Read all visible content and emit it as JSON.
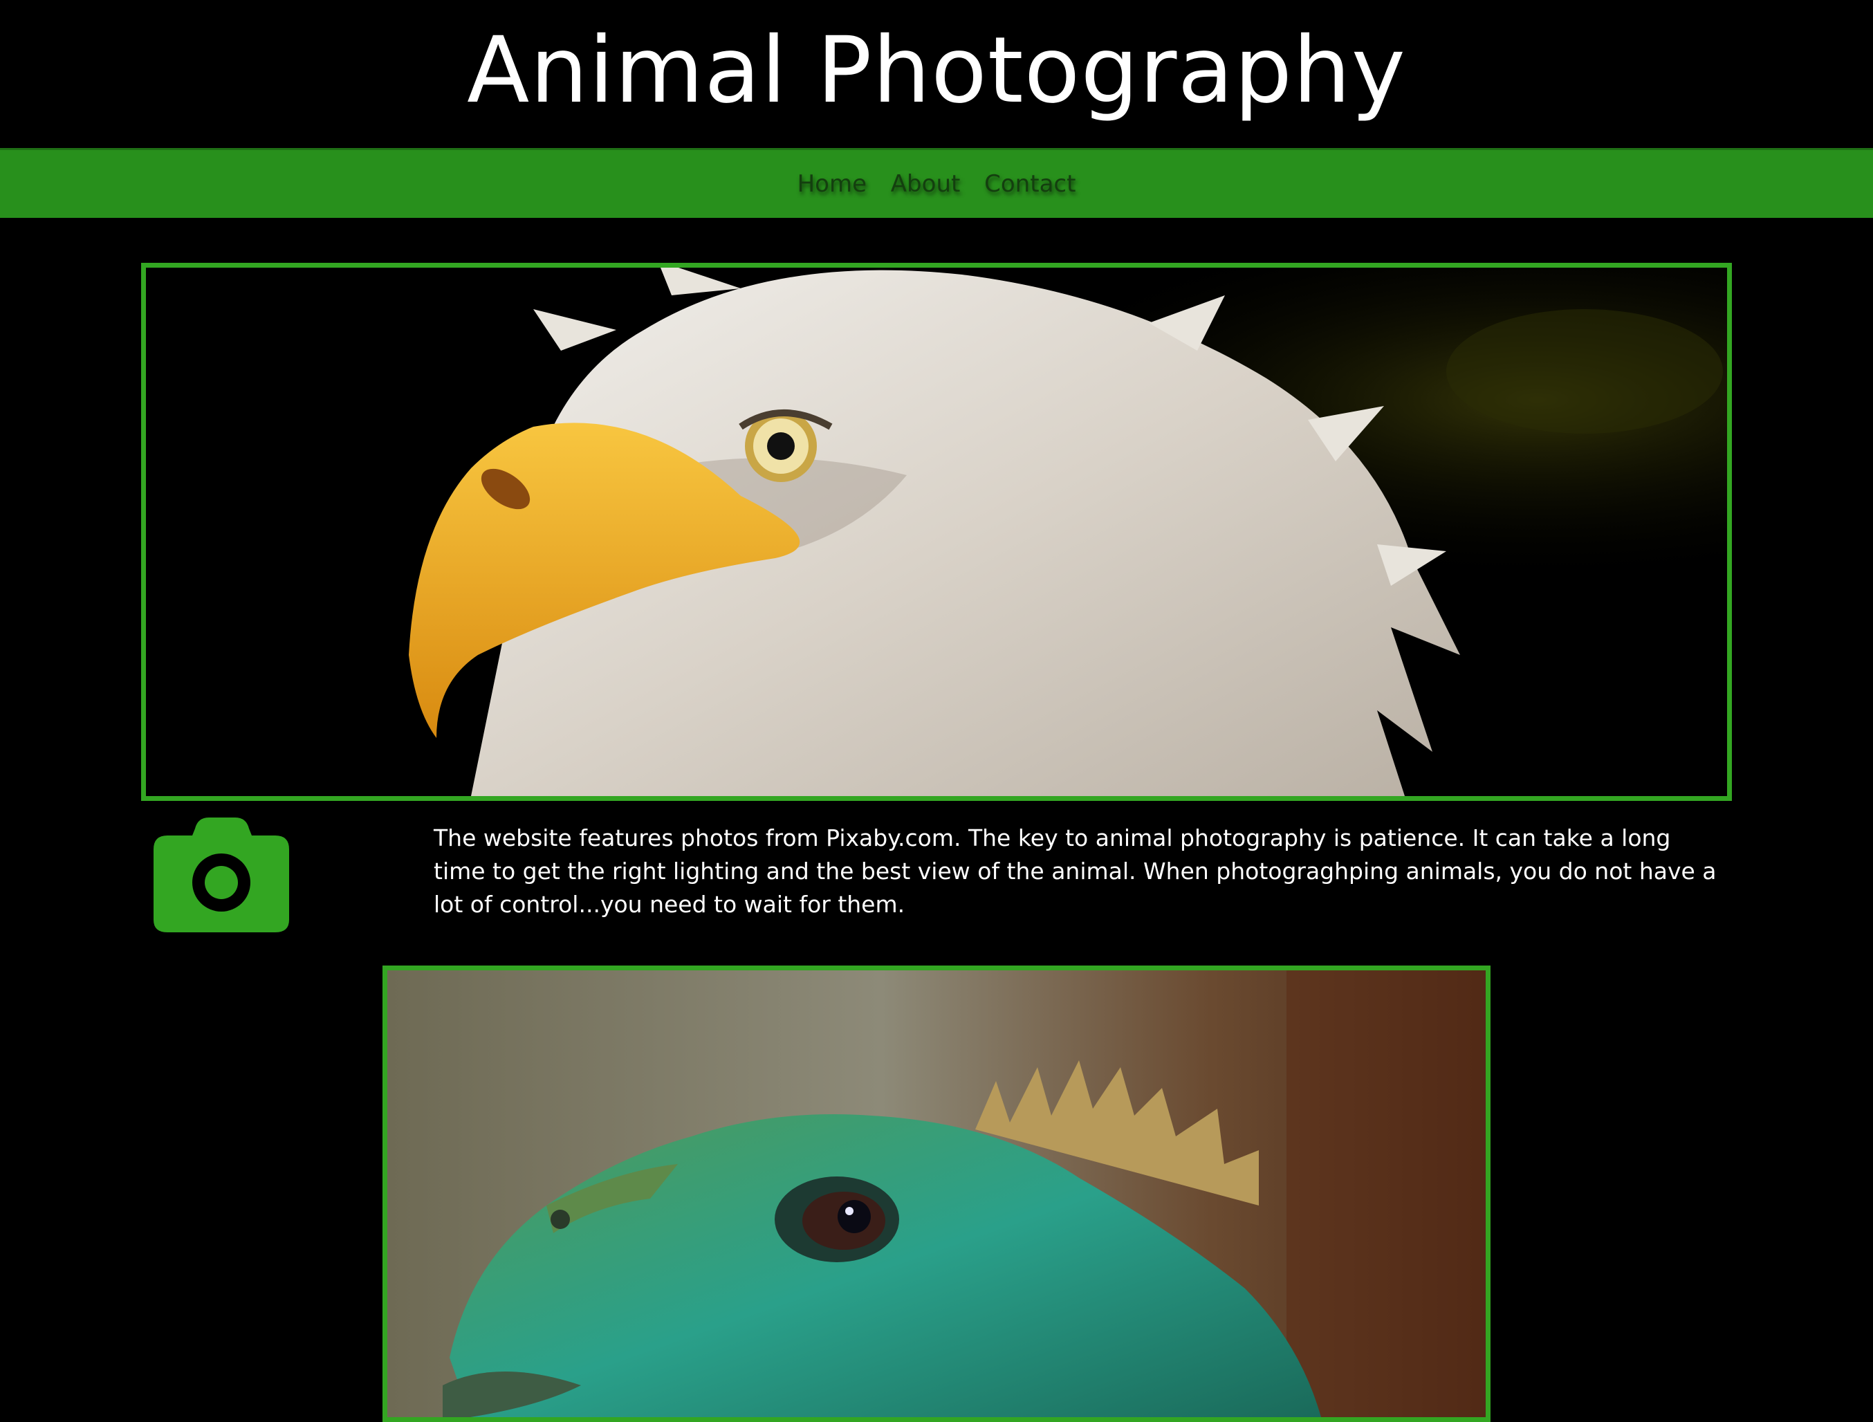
{
  "site": {
    "title": "Animal Photography",
    "accent_color": "#33a622",
    "nav_color": "#28901c"
  },
  "nav": {
    "items": [
      {
        "label": "Home"
      },
      {
        "label": "About"
      },
      {
        "label": "Contact"
      }
    ]
  },
  "main": {
    "photos": [
      {
        "subject": "bald eagle"
      },
      {
        "subject": "iguana"
      }
    ],
    "feature_icon": "camera-icon",
    "intro": "The website features photos from Pixaby.com. The key to animal photography is patience. It can take a long time to get the right lighting and the best view of the animal. When photograghping animals, you do not have a lot of control...you need to wait for them."
  }
}
